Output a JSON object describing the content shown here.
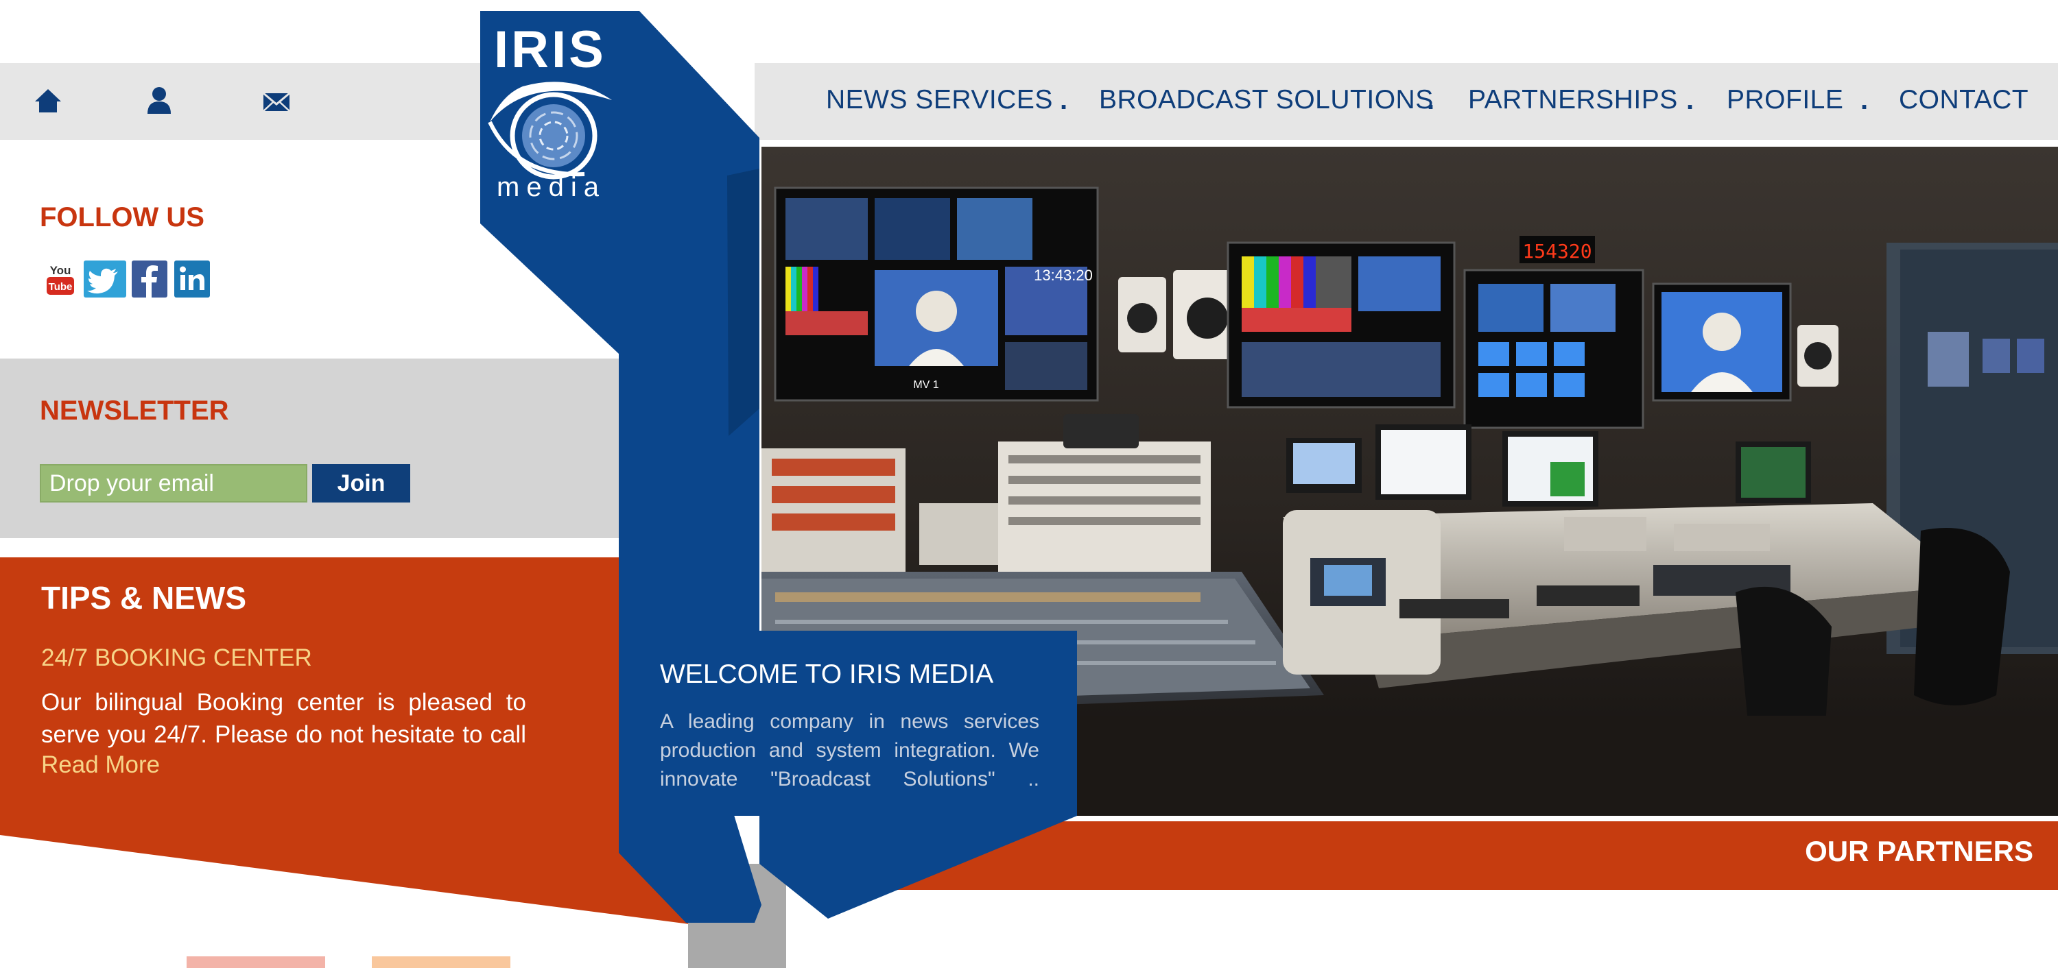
{
  "brand": {
    "logo_text": "IRIS",
    "logo_sub": "media"
  },
  "top_icons": [
    "home-icon",
    "user-icon",
    "mail-icon"
  ],
  "nav": {
    "items": [
      "NEWS SERVICES",
      "BROADCAST SOLUTIONS",
      "PARTNERSHIPS",
      "PROFILE",
      "CONTACT"
    ],
    "separator": "."
  },
  "follow": {
    "title": "FOLLOW US",
    "icons": [
      "youtube-icon",
      "twitter-icon",
      "facebook-icon",
      "linkedin-icon"
    ]
  },
  "newsletter": {
    "title": "NEWSLETTER",
    "placeholder": "Drop your email",
    "button": "Join"
  },
  "tips": {
    "title": "TIPS & NEWS",
    "subtitle": "24/7 BOOKING CENTER",
    "body": "Our bilingual Booking center is pleased to serve you 24/7. Please do not hesitate to call",
    "read_more": "Read More"
  },
  "welcome": {
    "title": "WELCOME TO IRIS MEDIA",
    "body": "A leading company in news services production and system integration. We innovate \"Broadcast Solutions\" .."
  },
  "partners": {
    "title": "OUR PARTNERS"
  },
  "hero": {
    "screen_time": "13:43:20",
    "clock": "154320",
    "monitor_label": "MV 1"
  },
  "colors": {
    "orange": "#c63c0f",
    "blue": "#0b468c",
    "navy": "#0f3f7a",
    "gray": "#e6e6e6"
  }
}
